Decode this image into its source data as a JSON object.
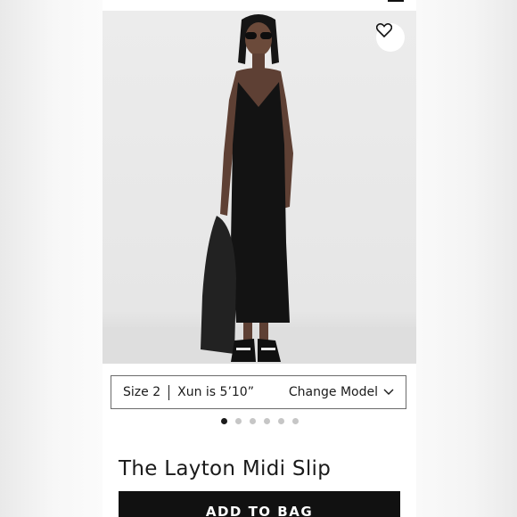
{
  "header": {
    "menu_icon": "menu-icon"
  },
  "product": {
    "wishlist_icon": "heart-icon",
    "size_bar": {
      "size_label": "Size 2",
      "model_info": "Xun is 5’10”",
      "change_label": "Change Model",
      "chevron_icon": "chevron-down-icon"
    },
    "carousel": {
      "total": 6,
      "active": 1
    },
    "title": "The Layton Midi Slip",
    "add_to_bag_label": "ADD TO BAG"
  }
}
